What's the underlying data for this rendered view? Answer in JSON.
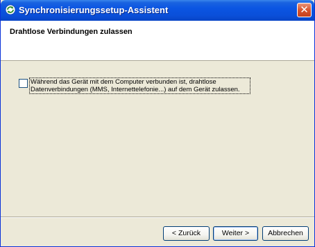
{
  "window": {
    "title": "Synchronisierungssetup-Assistent",
    "close_glyph": "✕",
    "icon": "sync-assistant-icon"
  },
  "header": {
    "title": "Drahtlose Verbindungen zulassen"
  },
  "option": {
    "checked": false,
    "label": "Während das Gerät mit dem Computer verbunden ist, drahtlose Datenverbindungen (MMS, Internettelefonie...) auf dem Gerät zulassen."
  },
  "buttons": {
    "back": "< Zurück",
    "next": "Weiter >",
    "cancel": "Abbrechen"
  },
  "colors": {
    "titlebar": "#0a4fd9",
    "dialog_bg": "#ece9d8",
    "header_bg": "#ffffff",
    "close_button": "#d9552e"
  }
}
